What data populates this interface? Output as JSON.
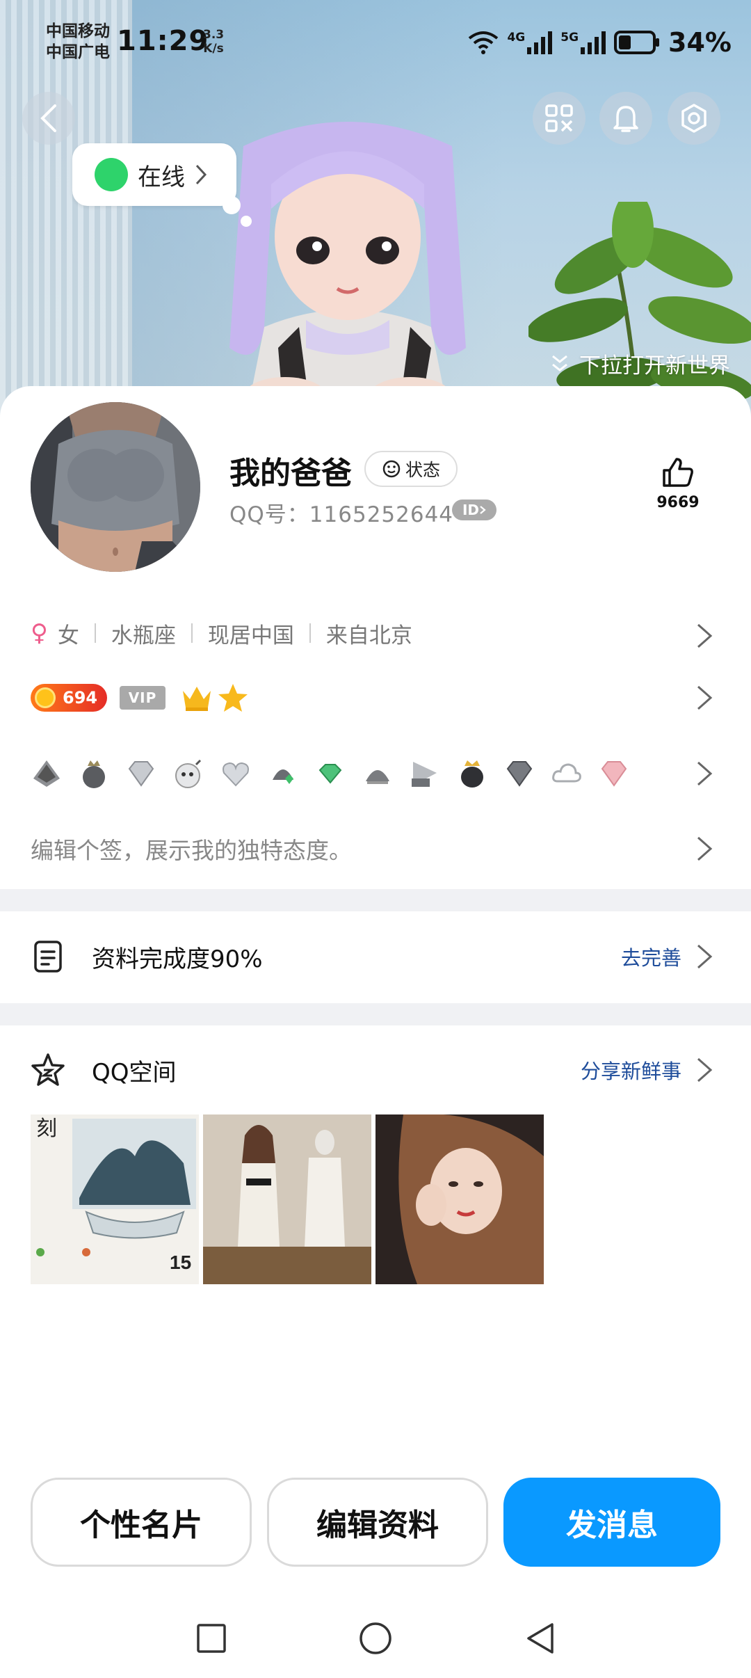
{
  "status_bar": {
    "carrier_line1": "中国移动",
    "carrier_line2": "中国广电",
    "time": "11:29",
    "speed_value": "3.3",
    "speed_unit": "K/s",
    "network_1": "4G",
    "network_2": "5G",
    "battery": "34%"
  },
  "header": {
    "online_status": "在线",
    "pull_hint": "下拉打开新世界"
  },
  "profile": {
    "nickname": "我的爸爸",
    "status_chip": "状态",
    "qq_number": "QQ号：1165252644",
    "id_badge": "ID",
    "likes": "9669"
  },
  "info": {
    "gender": "女",
    "constellation": "水瓶座",
    "residence": "现居中国",
    "hometown": "来自北京"
  },
  "badges": {
    "level": "694",
    "vip": "VIP"
  },
  "signature": {
    "placeholder": "编辑个签，展示我的独特态度。"
  },
  "completion": {
    "title": "资料完成度90%",
    "action": "去完善"
  },
  "qzone": {
    "title": "QQ空间",
    "action": "分享新鲜事",
    "photo1_date": "15"
  },
  "buttons": {
    "card": "个性名片",
    "edit": "编辑资料",
    "message": "发消息"
  },
  "colors": {
    "primary": "#0a99ff",
    "link": "#1f4d9b",
    "online": "#2ed36b"
  }
}
